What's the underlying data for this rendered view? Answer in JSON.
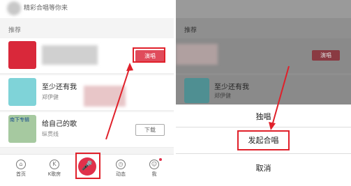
{
  "left": {
    "top_caption": "精彩合唱等你来",
    "section_label": "推荐",
    "songs": [
      {
        "title": "",
        "singer": "",
        "button": "演唱"
      },
      {
        "title": "至少还有我",
        "singer": "郑伊健",
        "button": ""
      },
      {
        "title": "给自己的歌",
        "singer": "纵贯线",
        "button": "下载"
      }
    ],
    "thumb_text": "南下专辑",
    "tabs": [
      {
        "label": "首页",
        "icon": "home-icon",
        "glyph": "⌂"
      },
      {
        "label": "K歌房",
        "icon": "k-room-icon",
        "glyph": "K"
      },
      {
        "label": "",
        "icon": "microphone-icon",
        "glyph": "🎤"
      },
      {
        "label": "动态",
        "icon": "clock-icon",
        "glyph": "◷"
      },
      {
        "label": "我",
        "icon": "user-icon",
        "glyph": "☺"
      }
    ]
  },
  "right": {
    "section_label": "推荐",
    "songs": [
      {
        "title": "",
        "singer": "",
        "button": "演唱"
      },
      {
        "title": "至少还有我",
        "singer": "郑伊健"
      }
    ],
    "sheet": {
      "solo": "独唱",
      "chorus": "发起合唱",
      "cancel": "取消"
    }
  },
  "colors": {
    "accent": "#e04b5b",
    "highlight": "#e0202a"
  }
}
